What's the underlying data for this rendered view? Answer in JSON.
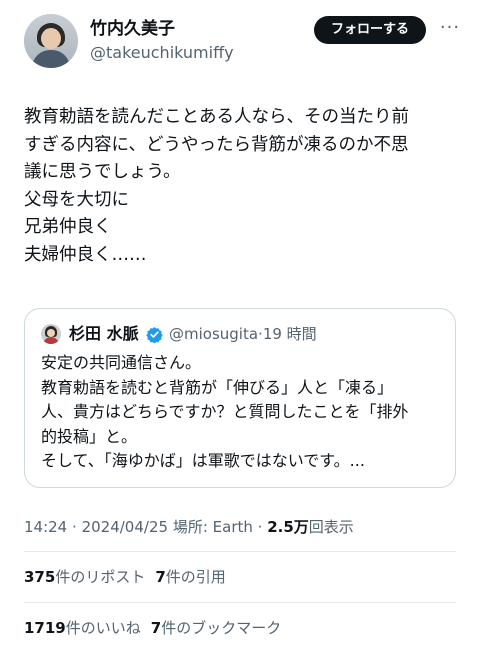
{
  "author": {
    "name": "竹内久美子",
    "handle": "@takeuchikumiffy"
  },
  "follow_button": "フォローする",
  "more_menu": "···",
  "tweet": {
    "lines": [
      "教育勅語を読んだことある人なら、その当たり前",
      "すぎる内容に、どうやったら背筋が凍るのか不思",
      "議に思うでしょう。",
      "父母を大切に",
      "兄弟仲良く",
      "夫婦仲良く……"
    ]
  },
  "quoted": {
    "name": "杉田 水脈",
    "handle": "@miosugita",
    "separator": "·",
    "time": "19 時間",
    "verified_color": "#1d9bf0",
    "lines": [
      "安定の共同通信さん。",
      "教育勅語を読むと背筋が「伸びる」人と「凍る」",
      "人、貴方はどちらですか？と質問したことを「排外",
      "的投稿」と。",
      "そして、「海ゆかば」は軍歌ではないです。..."
    ]
  },
  "meta": {
    "time": "14:24",
    "dot1": "·",
    "date": "2024/04/25",
    "location_label": "場所: Earth",
    "dot2": "·",
    "views_count": "2.5万",
    "views_label": "回表示"
  },
  "stats": {
    "retweets_count": "375",
    "retweets_label": "件のリポスト",
    "quotes_count": "7",
    "quotes_label": "件の引用",
    "likes_count": "1719",
    "likes_label": "件のいいね",
    "bookmarks_count": "7",
    "bookmarks_label": "件のブックマーク"
  }
}
